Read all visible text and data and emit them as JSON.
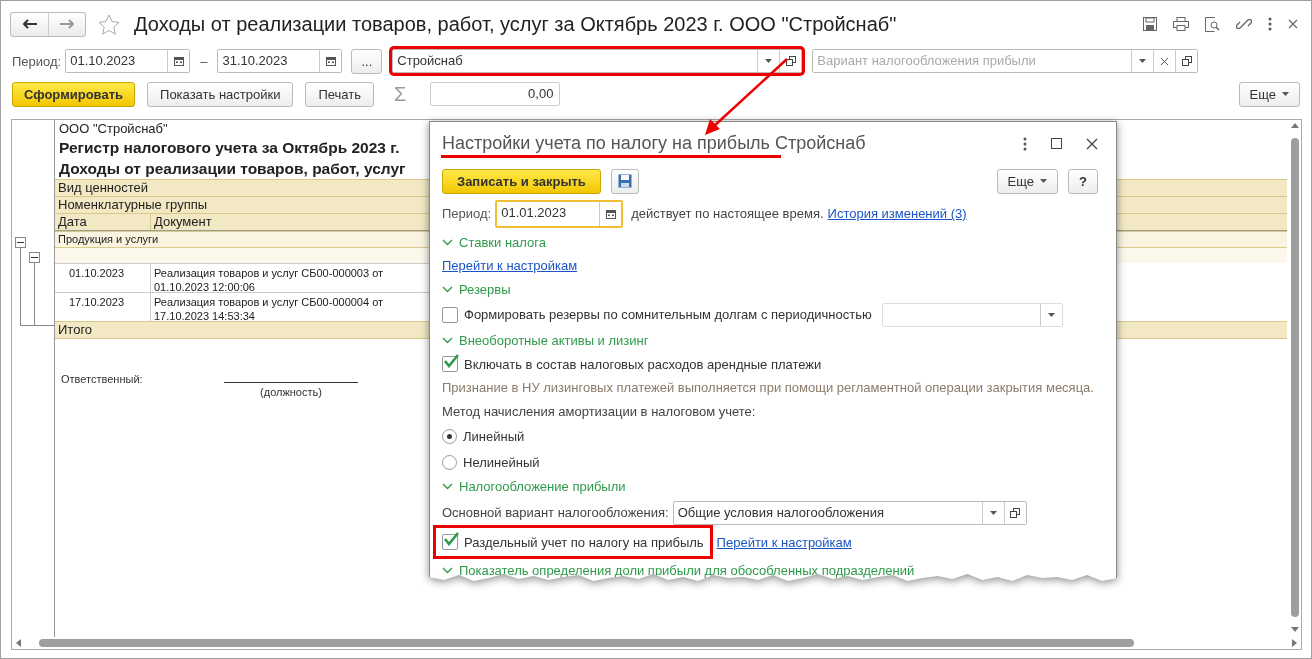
{
  "window": {
    "title": "Доходы от реализации товаров, работ, услуг за Октябрь 2023 г. ООО \"Стройснаб\""
  },
  "filters": {
    "period_label": "Период:",
    "date_from": "01.10.2023",
    "dash": "–",
    "date_to": "31.10.2023",
    "more": "...",
    "organization": "Стройснаб",
    "organization_highlighted": true,
    "tax_variant_placeholder": "Вариант налогообложения прибыли"
  },
  "toolbar": {
    "generate": "Сформировать",
    "show_settings": "Показать настройки",
    "print": "Печать",
    "sigma": "Σ",
    "sum": "0,00",
    "more": "Еще"
  },
  "report": {
    "company": "ООО \"Стройснаб\"",
    "title_lines": [
      "Регистр налогового учета за Октябрь 2023 г.",
      "Доходы от реализации товаров, работ, услуг"
    ],
    "header_rows": [
      "Вид ценностей",
      "Номенклатурные группы"
    ],
    "columns": [
      "Дата",
      "Документ"
    ],
    "group": {
      "label": "Продукция и услуги",
      "expanded": true
    },
    "subgroup": {
      "expanded": true
    },
    "rows": [
      {
        "date": "01.10.2023",
        "document": "Реализация товаров и услуг СБ00-000003 от 01.10.2023 12:00:06"
      },
      {
        "date": "17.10.2023",
        "document": "Реализация товаров и услуг СБ00-000004 от 17.10.2023 14:53:34"
      }
    ],
    "total": "Итого",
    "responsible_label": "Ответственный:",
    "position_caption": "(должность)"
  },
  "dialog": {
    "title": "Настройки учета по налогу на прибыль Стройснаб",
    "save_close": "Записать и закрыть",
    "more": "Еще",
    "help": "?",
    "period_label": "Период:",
    "period": "01.01.2023",
    "valid_text": "действует по настоящее время.",
    "history_link": "История изменений (3)",
    "sections": [
      {
        "title": "Ставки налога",
        "expanded": true,
        "items": [
          {
            "kind": "link",
            "text": "Перейти к настройкам"
          }
        ]
      },
      {
        "title": "Резервы",
        "expanded": true,
        "items": [
          {
            "kind": "checkbox_select",
            "label": "Формировать резервы по сомнительным долгам с периодичностью",
            "checked": false
          }
        ]
      },
      {
        "title": "Внеоборотные активы и лизинг",
        "expanded": true,
        "items": [
          {
            "kind": "checkbox",
            "label": "Включать в состав налоговых расходов арендные платежи",
            "checked": true
          },
          {
            "kind": "note",
            "text": "Признание в НУ лизинговых платежей выполняется при помощи регламентной операции закрытия месяца."
          },
          {
            "kind": "label",
            "text": "Метод начисления амортизации в налоговом учете:"
          },
          {
            "kind": "radio",
            "label": "Линейный",
            "selected": true
          },
          {
            "kind": "radio",
            "label": "Нелинейный",
            "selected": false
          }
        ]
      },
      {
        "title": "Налогообложение прибыли",
        "expanded": true,
        "items": [
          {
            "kind": "select",
            "label": "Основной вариант налогообложения:",
            "value": "Общие условия налогообложения"
          },
          {
            "kind": "checkbox_link",
            "label": "Раздельный учет по налогу на прибыль",
            "checked": true,
            "link": "Перейти к настройкам",
            "highlighted": true
          }
        ]
      },
      {
        "title": "Показатель определения доли прибыли для обособленных подразделений",
        "expanded": true
      }
    ]
  }
}
